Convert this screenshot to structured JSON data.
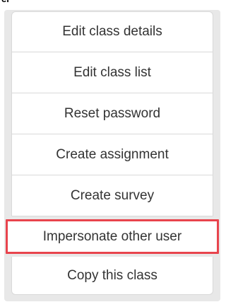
{
  "header": {
    "fragment_text": "er"
  },
  "menu": {
    "items": [
      {
        "label": "Edit class details"
      },
      {
        "label": "Edit class list"
      },
      {
        "label": "Reset password"
      },
      {
        "label": "Create assignment"
      },
      {
        "label": "Create survey"
      },
      {
        "label": "Impersonate other user",
        "highlighted": true,
        "highlight_color": "#e8444d"
      },
      {
        "label": "Copy this class"
      }
    ]
  }
}
